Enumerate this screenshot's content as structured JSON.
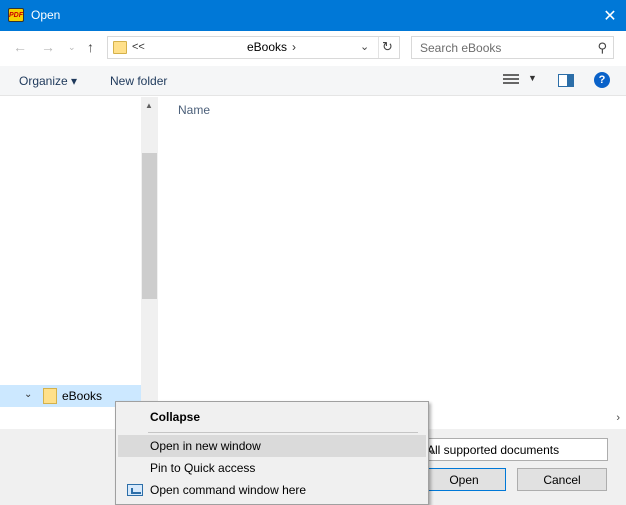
{
  "window": {
    "title": "Open",
    "app_icon": "PDF"
  },
  "address": {
    "ellipsis": "<<",
    "crumb": "eBooks",
    "crumb_chevron": "›"
  },
  "search": {
    "placeholder": "Search eBooks"
  },
  "toolbar": {
    "organize_label": "Organize ▾",
    "new_folder_label": "New folder",
    "help_label": "?"
  },
  "nav": {
    "items": [
      {
        "label": "eBooks"
      }
    ]
  },
  "content": {
    "column_name": "Name"
  },
  "footer": {
    "filetype_value": "All supported documents",
    "open_label": "Open",
    "cancel_label": "Cancel"
  },
  "context_menu": {
    "items": [
      {
        "label": "Collapse",
        "bold": true
      },
      {
        "label": "Open in new window",
        "highlighted": true
      },
      {
        "label": "Pin to Quick access"
      },
      {
        "label": "Open command window here"
      }
    ]
  },
  "colors": {
    "titlebar": "#0078d7",
    "selection": "#cce8ff",
    "folder": "#ffe08a"
  }
}
